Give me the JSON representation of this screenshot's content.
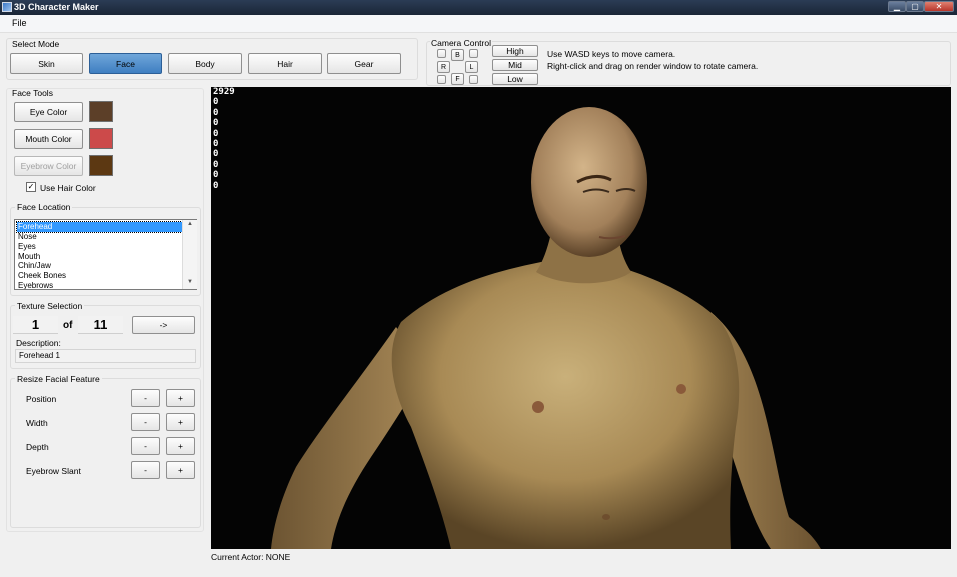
{
  "window": {
    "title": "3D Character Maker"
  },
  "menu": {
    "file": "File"
  },
  "select_mode": {
    "label": "Select Mode",
    "buttons": [
      "Skin",
      "Face",
      "Body",
      "Hair",
      "Gear"
    ],
    "active": "Face"
  },
  "camera": {
    "label": "Camera Control",
    "dir_buttons": {
      "b": "B",
      "r": "R",
      "l": "L",
      "f": "F"
    },
    "levels": [
      "High",
      "Mid",
      "Low"
    ],
    "hint_move": "Use WASD keys to move camera.",
    "hint_rotate": "Right-click and drag on render window to rotate camera."
  },
  "face_tools": {
    "label": "Face Tools",
    "eye_color_label": "Eye Color",
    "mouth_color_label": "Mouth Color",
    "eyebrow_color_label": "Eyebrow Color",
    "colors": {
      "eye": "#5c3f28",
      "mouth": "#cc4a4a",
      "eyebrow": "#5c3812"
    },
    "use_hair_color_label": "Use Hair Color",
    "use_hair_color_checked": true
  },
  "face_location": {
    "label": "Face Location",
    "items": [
      "Forehead",
      "Nose",
      "Eyes",
      "Mouth",
      "Chin/Jaw",
      "Cheek Bones",
      "Eyebrows"
    ],
    "selected": "Forehead"
  },
  "texture_selection": {
    "label": "Texture Selection",
    "current": "1",
    "of_label": "of",
    "total": "11",
    "next_label": "->",
    "description_label": "Description:",
    "description": "Forehead 1"
  },
  "resize": {
    "label": "Resize Facial Feature",
    "features": [
      "Position",
      "Width",
      "Depth",
      "Eyebrow Slant"
    ],
    "minus_label": "-",
    "plus_label": "+"
  },
  "render": {
    "stats": [
      "2929",
      "0",
      "0",
      "0",
      "0",
      "0",
      "0",
      "0",
      "0",
      "0"
    ]
  },
  "status": {
    "current_actor": "Current Actor: NONE"
  }
}
